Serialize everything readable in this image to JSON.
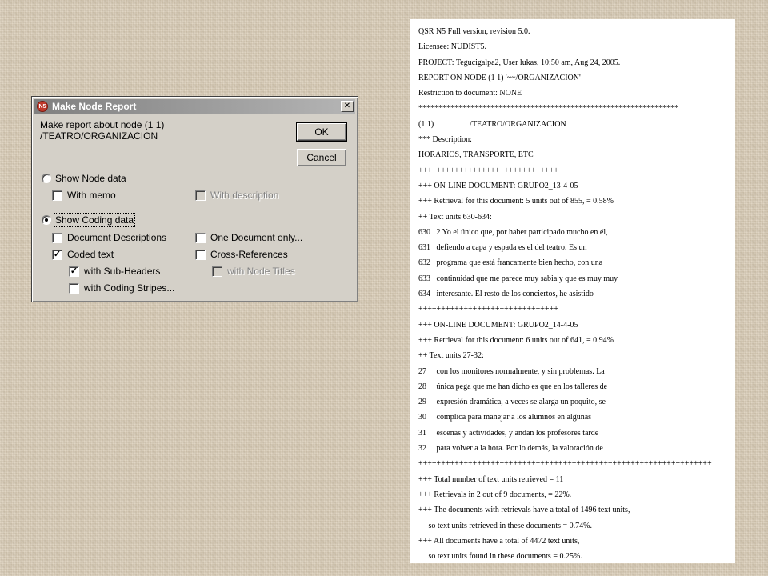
{
  "dialog": {
    "title": "Make Node Report",
    "icon_text": "N5",
    "close_glyph": "✕",
    "prompt_line1": "Make report about node (1 1)",
    "prompt_line2": "/TEATRO/ORGANIZACION",
    "ok_label": "OK",
    "cancel_label": "Cancel",
    "show_node_data_label": "Show Node data",
    "with_memo_label": "With memo",
    "with_description_label": "With description",
    "show_coding_data_label": "Show Coding data",
    "document_descriptions_label": "Document Descriptions",
    "one_document_only_label": "One Document only...",
    "coded_text_label": "Coded text",
    "cross_references_label": "Cross-References",
    "with_sub_headers_label": "with Sub-Headers",
    "with_node_titles_label": "with Node Titles",
    "with_coding_stripes_label": "with Coding Stripes...",
    "check_glyph": "✓"
  },
  "report": {
    "lines": [
      "QSR N5 Full version, revision 5.0.",
      "Licensee: NUDIST5.",
      "PROJECT: Tegucigalpa2, User lukas, 10:50 am, Aug 24, 2005.",
      "REPORT ON NODE (1 1) '~~/ORGANIZACION'",
      "Restriction to document: NONE",
      "*****************************************************************",
      "(1 1)                  /TEATRO/ORGANIZACION",
      "*** Description:",
      "HORARIOS, TRANSPORTE, ETC",
      "+++++++++++++++++++++++++++++++",
      "+++ ON-LINE DOCUMENT: GRUPO2_13-4-05",
      "+++ Retrieval for this document: 5 units out of 855, = 0.58%",
      "++ Text units 630-634:",
      "630   2 Yo el único que, por haber participado mucho en él,",
      "631   defiendo a capa y espada es el del teatro. Es un",
      "632   programa que está francamente bien hecho, con una",
      "633   continuidad que me parece muy sabia y que es muy muy",
      "634   interesante. El resto de los conciertos, he asistido",
      "+++++++++++++++++++++++++++++++",
      "+++ ON-LINE DOCUMENT: GRUPO2_14-4-05",
      "+++ Retrieval for this document: 6 units out of 641, = 0.94%",
      "++ Text units 27-32:",
      "27     con los monitores normalmente, y sin problemas. La",
      "28     única pega que me han dicho es que en los talleres de",
      "29     expresión dramática, a veces se alarga un poquito, se",
      "30     complica para manejar a los alumnos en algunas",
      "31     escenas y actividades, y andan los profesores tarde",
      "32     para volver a la hora. Por lo demás, la valoración de",
      "+++++++++++++++++++++++++++++++++++++++++++++++++++++++++++++++++",
      "+++ Total number of text units retrieved = 11",
      "+++ Retrievals in 2 out of 9 documents, = 22%.",
      "+++ The documents with retrievals have a total of 1496 text units,",
      "     so text units retrieved in these documents = 0.74%.",
      "+++ All documents have a total of 4472 text units,",
      "     so text units found in these documents = 0.25%."
    ]
  }
}
